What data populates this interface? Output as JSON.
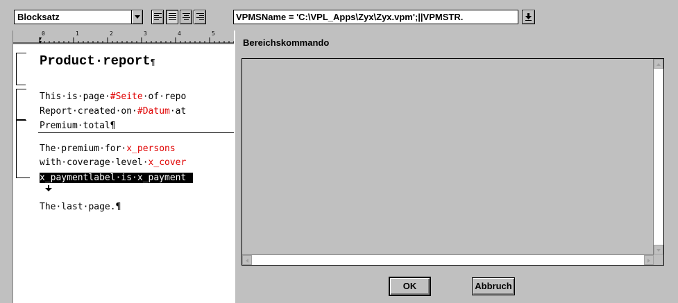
{
  "toolbar": {
    "paragraph_style": "Blocksatz",
    "align_buttons": [
      "align-left",
      "justify",
      "align-center",
      "align-right"
    ],
    "formula": "VPMSName = 'C:\\VPL_Apps\\Zyx\\Zyx.vpm';||VPMSTR."
  },
  "document": {
    "ruler_labels": [
      "0",
      "1",
      "2",
      "3",
      "4",
      "5"
    ],
    "heading": "Product·report",
    "pilcrow": "¶",
    "line1_a": "This·is·page·",
    "line1_field": "#Seite",
    "line1_b": "·of·repo",
    "line2_a": "Report·created·on·",
    "line2_field": "#Datum",
    "line2_b": "·at",
    "line3": "Premium·total¶",
    "line4_a": "The·premium·for·",
    "line4_field": "x_persons",
    "line5_a": "with·coverage·level·",
    "line5_field": "x_cover",
    "line6": "x_paymentlabel·is·x_payment",
    "line7": "The·last·page.¶"
  },
  "dialog": {
    "title": "Bereichskommando",
    "ok_label": "OK",
    "cancel_label": "Abbruch"
  },
  "colors": {
    "field": "#e00000",
    "background": "#c0c0c0"
  }
}
